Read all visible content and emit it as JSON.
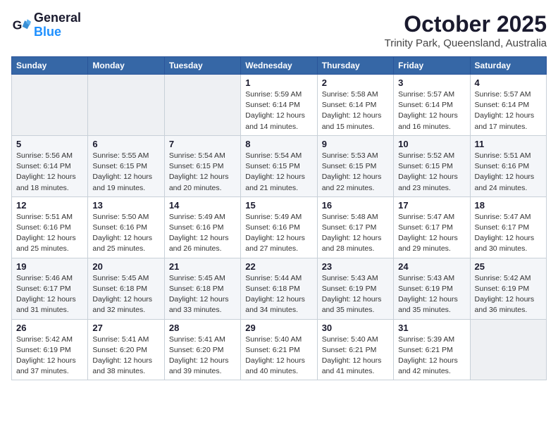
{
  "header": {
    "logo_line1": "General",
    "logo_line2": "Blue",
    "month": "October 2025",
    "location": "Trinity Park, Queensland, Australia"
  },
  "weekdays": [
    "Sunday",
    "Monday",
    "Tuesday",
    "Wednesday",
    "Thursday",
    "Friday",
    "Saturday"
  ],
  "weeks": [
    [
      {
        "day": "",
        "info": ""
      },
      {
        "day": "",
        "info": ""
      },
      {
        "day": "",
        "info": ""
      },
      {
        "day": "1",
        "info": "Sunrise: 5:59 AM\nSunset: 6:14 PM\nDaylight: 12 hours\nand 14 minutes."
      },
      {
        "day": "2",
        "info": "Sunrise: 5:58 AM\nSunset: 6:14 PM\nDaylight: 12 hours\nand 15 minutes."
      },
      {
        "day": "3",
        "info": "Sunrise: 5:57 AM\nSunset: 6:14 PM\nDaylight: 12 hours\nand 16 minutes."
      },
      {
        "day": "4",
        "info": "Sunrise: 5:57 AM\nSunset: 6:14 PM\nDaylight: 12 hours\nand 17 minutes."
      }
    ],
    [
      {
        "day": "5",
        "info": "Sunrise: 5:56 AM\nSunset: 6:14 PM\nDaylight: 12 hours\nand 18 minutes."
      },
      {
        "day": "6",
        "info": "Sunrise: 5:55 AM\nSunset: 6:15 PM\nDaylight: 12 hours\nand 19 minutes."
      },
      {
        "day": "7",
        "info": "Sunrise: 5:54 AM\nSunset: 6:15 PM\nDaylight: 12 hours\nand 20 minutes."
      },
      {
        "day": "8",
        "info": "Sunrise: 5:54 AM\nSunset: 6:15 PM\nDaylight: 12 hours\nand 21 minutes."
      },
      {
        "day": "9",
        "info": "Sunrise: 5:53 AM\nSunset: 6:15 PM\nDaylight: 12 hours\nand 22 minutes."
      },
      {
        "day": "10",
        "info": "Sunrise: 5:52 AM\nSunset: 6:15 PM\nDaylight: 12 hours\nand 23 minutes."
      },
      {
        "day": "11",
        "info": "Sunrise: 5:51 AM\nSunset: 6:16 PM\nDaylight: 12 hours\nand 24 minutes."
      }
    ],
    [
      {
        "day": "12",
        "info": "Sunrise: 5:51 AM\nSunset: 6:16 PM\nDaylight: 12 hours\nand 25 minutes."
      },
      {
        "day": "13",
        "info": "Sunrise: 5:50 AM\nSunset: 6:16 PM\nDaylight: 12 hours\nand 25 minutes."
      },
      {
        "day": "14",
        "info": "Sunrise: 5:49 AM\nSunset: 6:16 PM\nDaylight: 12 hours\nand 26 minutes."
      },
      {
        "day": "15",
        "info": "Sunrise: 5:49 AM\nSunset: 6:16 PM\nDaylight: 12 hours\nand 27 minutes."
      },
      {
        "day": "16",
        "info": "Sunrise: 5:48 AM\nSunset: 6:17 PM\nDaylight: 12 hours\nand 28 minutes."
      },
      {
        "day": "17",
        "info": "Sunrise: 5:47 AM\nSunset: 6:17 PM\nDaylight: 12 hours\nand 29 minutes."
      },
      {
        "day": "18",
        "info": "Sunrise: 5:47 AM\nSunset: 6:17 PM\nDaylight: 12 hours\nand 30 minutes."
      }
    ],
    [
      {
        "day": "19",
        "info": "Sunrise: 5:46 AM\nSunset: 6:17 PM\nDaylight: 12 hours\nand 31 minutes."
      },
      {
        "day": "20",
        "info": "Sunrise: 5:45 AM\nSunset: 6:18 PM\nDaylight: 12 hours\nand 32 minutes."
      },
      {
        "day": "21",
        "info": "Sunrise: 5:45 AM\nSunset: 6:18 PM\nDaylight: 12 hours\nand 33 minutes."
      },
      {
        "day": "22",
        "info": "Sunrise: 5:44 AM\nSunset: 6:18 PM\nDaylight: 12 hours\nand 34 minutes."
      },
      {
        "day": "23",
        "info": "Sunrise: 5:43 AM\nSunset: 6:19 PM\nDaylight: 12 hours\nand 35 minutes."
      },
      {
        "day": "24",
        "info": "Sunrise: 5:43 AM\nSunset: 6:19 PM\nDaylight: 12 hours\nand 35 minutes."
      },
      {
        "day": "25",
        "info": "Sunrise: 5:42 AM\nSunset: 6:19 PM\nDaylight: 12 hours\nand 36 minutes."
      }
    ],
    [
      {
        "day": "26",
        "info": "Sunrise: 5:42 AM\nSunset: 6:19 PM\nDaylight: 12 hours\nand 37 minutes."
      },
      {
        "day": "27",
        "info": "Sunrise: 5:41 AM\nSunset: 6:20 PM\nDaylight: 12 hours\nand 38 minutes."
      },
      {
        "day": "28",
        "info": "Sunrise: 5:41 AM\nSunset: 6:20 PM\nDaylight: 12 hours\nand 39 minutes."
      },
      {
        "day": "29",
        "info": "Sunrise: 5:40 AM\nSunset: 6:21 PM\nDaylight: 12 hours\nand 40 minutes."
      },
      {
        "day": "30",
        "info": "Sunrise: 5:40 AM\nSunset: 6:21 PM\nDaylight: 12 hours\nand 41 minutes."
      },
      {
        "day": "31",
        "info": "Sunrise: 5:39 AM\nSunset: 6:21 PM\nDaylight: 12 hours\nand 42 minutes."
      },
      {
        "day": "",
        "info": ""
      }
    ]
  ]
}
